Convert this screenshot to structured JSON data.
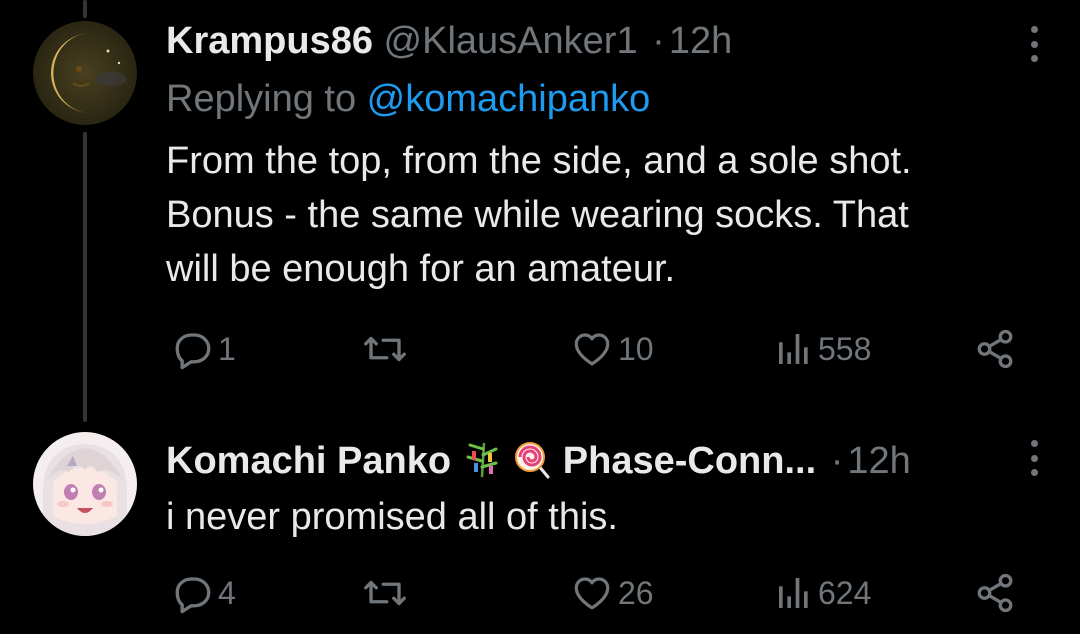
{
  "tweets": [
    {
      "display_name": "Krampus86",
      "handle": "@KlausAnker1",
      "separator": "·",
      "time": "12h",
      "replying_prefix": "Replying to ",
      "replying_to": "@komachipanko",
      "body_lines": [
        "From the top, from the side, and a sole shot.",
        "Bonus - the same while wearing socks. That",
        "will be enough for an amateur."
      ],
      "reply_count": "1",
      "retweet_count": "",
      "like_count": "10",
      "view_count": "558"
    },
    {
      "display_name": "Komachi Panko",
      "name_suffix": "Phase-Conn...",
      "separator": "·",
      "time": "12h",
      "body_lines": [
        "i never promised all of this."
      ],
      "reply_count": "4",
      "retweet_count": "",
      "like_count": "26",
      "view_count": "624"
    }
  ],
  "colors": {
    "background": "#000000",
    "text": "#e7e9ea",
    "muted": "#71767b",
    "link": "#1d9bf0",
    "thread_line": "#333639"
  },
  "icons": {
    "reply": "reply-bubble-icon",
    "retweet": "retweet-icon",
    "like": "heart-icon",
    "views": "bar-chart-icon",
    "share": "share-icon",
    "more": "more-vertical-icon",
    "emoji_1": "tanabata-tree-emoji",
    "emoji_2": "lollipop-emoji"
  }
}
